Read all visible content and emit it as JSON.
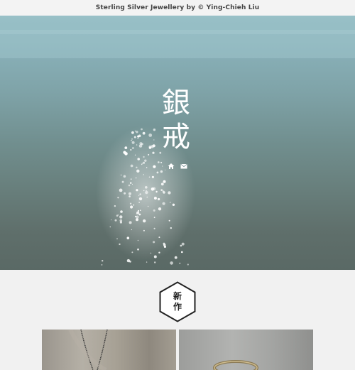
{
  "header": {
    "title": "Sterling Silver Jewellery by © Ying-Chieh Liu"
  },
  "hero": {
    "logo_char_1": "銀",
    "logo_char_2": "戒",
    "icons": [
      "home-icon",
      "mail-icon"
    ]
  },
  "section": {
    "badge_line_1": "新",
    "badge_line_2": "作"
  },
  "colors": {
    "water_top": "#8fb8c0",
    "water_bottom": "#5a6965",
    "page_bg": "#f1f1f1",
    "badge_stroke": "#222222"
  }
}
